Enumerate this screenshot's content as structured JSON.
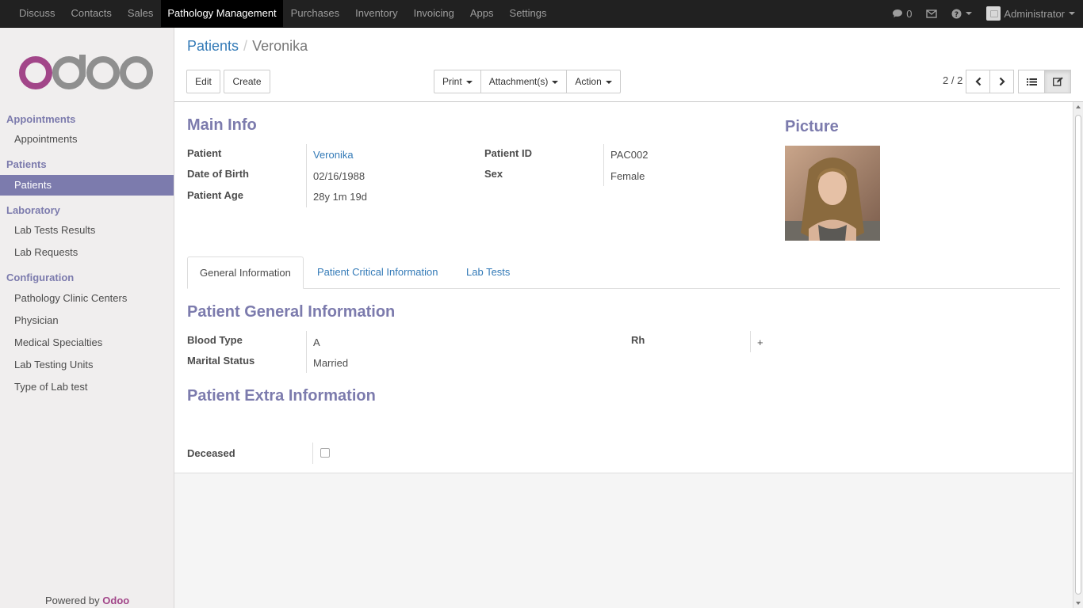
{
  "topbar": {
    "menu": [
      "Discuss",
      "Contacts",
      "Sales",
      "Pathology Management",
      "Purchases",
      "Inventory",
      "Invoicing",
      "Apps",
      "Settings"
    ],
    "active_menu": "Pathology Management",
    "messages_count": "0",
    "user": "Administrator"
  },
  "sidebar": {
    "sections": [
      {
        "title": "Appointments",
        "items": [
          "Appointments"
        ]
      },
      {
        "title": "Patients",
        "items": [
          "Patients"
        ]
      },
      {
        "title": "Laboratory",
        "items": [
          "Lab Tests Results",
          "Lab Requests"
        ]
      },
      {
        "title": "Configuration",
        "items": [
          "Pathology Clinic Centers",
          "Physician",
          "Medical Specialties",
          "Lab Testing Units",
          "Type of Lab test"
        ]
      }
    ],
    "active_item": "Patients",
    "powered_by": "Powered by",
    "powered_brand": "Odoo"
  },
  "breadcrumb": {
    "parent": "Patients",
    "current": "Veronika"
  },
  "buttons": {
    "edit": "Edit",
    "create": "Create",
    "print": "Print",
    "attachments": "Attachment(s)",
    "action": "Action"
  },
  "pager": {
    "value": "2 / 2"
  },
  "form": {
    "main_info_title": "Main Info",
    "picture_title": "Picture",
    "fields": {
      "patient_label": "Patient",
      "patient_value": "Veronika",
      "dob_label": "Date of Birth",
      "dob_value": "02/16/1988",
      "age_label": "Patient Age",
      "age_value": "28y 1m 19d",
      "patient_id_label": "Patient ID",
      "patient_id_value": "PAC002",
      "sex_label": "Sex",
      "sex_value": "Female"
    },
    "tabs": [
      "General Information",
      "Patient Critical Information",
      "Lab Tests"
    ],
    "active_tab": "General Information",
    "general_title": "Patient General Information",
    "general": {
      "blood_type_label": "Blood Type",
      "blood_type_value": "A",
      "rh_label": "Rh",
      "rh_value": "+",
      "marital_label": "Marital Status",
      "marital_value": "Married"
    },
    "extra_title": "Patient Extra Information",
    "deceased_label": "Deceased"
  },
  "colors": {
    "accent": "#7c7bad",
    "link": "#337ab7",
    "topbar": "#212121",
    "brand": "#a24689"
  },
  "icons": [
    "chat-icon",
    "envelope-icon",
    "help-icon",
    "chevron-left-icon",
    "chevron-right-icon",
    "list-view-icon",
    "form-view-icon"
  ]
}
